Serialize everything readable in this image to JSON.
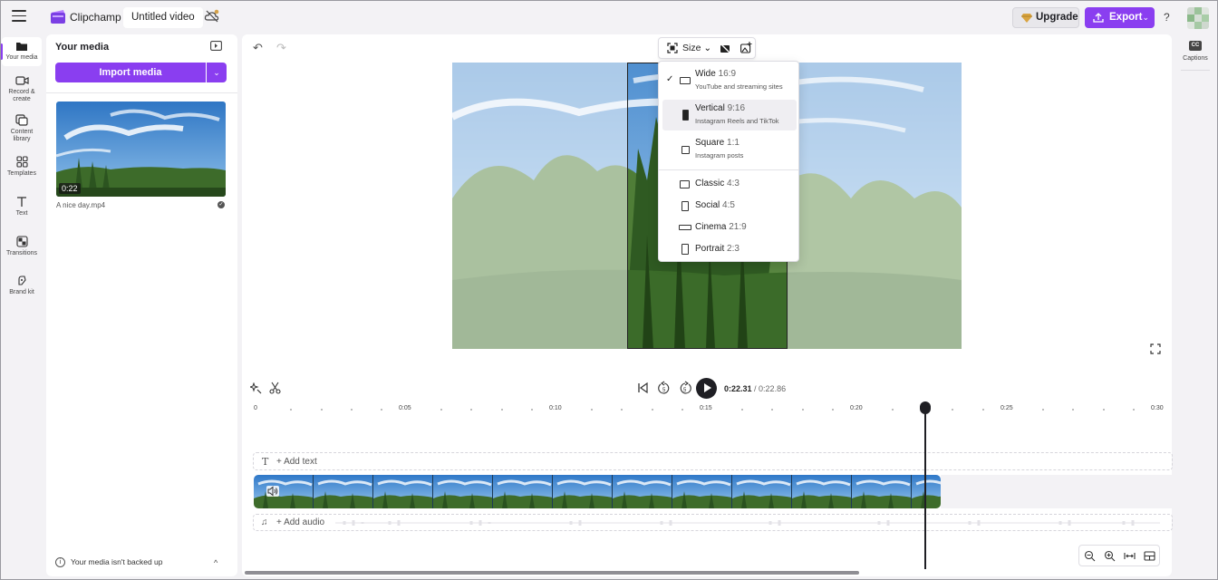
{
  "app": {
    "name": "Clipchamp",
    "project_title": "Untitled video"
  },
  "header": {
    "upgrade_label": "Upgrade",
    "export_label": "Export",
    "export_dropdown": "⌄",
    "help_label": "?"
  },
  "rail": {
    "items": [
      {
        "label": "Your media",
        "icon": "folder-icon",
        "active": true
      },
      {
        "label": "Record & create",
        "icon": "camera-icon"
      },
      {
        "label": "Content library",
        "icon": "library-icon"
      },
      {
        "label": "Templates",
        "icon": "templates-icon"
      },
      {
        "label": "Text",
        "icon": "text-icon"
      },
      {
        "label": "Transitions",
        "icon": "transitions-icon"
      },
      {
        "label": "Brand kit",
        "icon": "brand-kit-icon"
      }
    ]
  },
  "media": {
    "title": "Your media",
    "import_label": "Import media",
    "import_dropdown": "⌄",
    "file": {
      "duration": "0:22",
      "name": "A nice day.mp4"
    },
    "backup_text": "Your media isn't backed up",
    "backup_chevron": "^"
  },
  "toolbar": {
    "size_label": "Size",
    "size_chevron": "⌄"
  },
  "size_menu": {
    "options": [
      {
        "name": "Wide",
        "ratio": "16:9",
        "desc": "YouTube and streaming sites",
        "checked": true
      },
      {
        "name": "Vertical",
        "ratio": "9:16",
        "desc": "Instagram Reels and TikTok",
        "highlighted": true
      },
      {
        "name": "Square",
        "ratio": "1:1",
        "desc": "Instagram posts"
      },
      {
        "name": "Classic",
        "ratio": "4:3"
      },
      {
        "name": "Social",
        "ratio": "4:5"
      },
      {
        "name": "Cinema",
        "ratio": "21:9"
      },
      {
        "name": "Portrait",
        "ratio": "2:3"
      }
    ],
    "check_mark": "✓"
  },
  "transport": {
    "current_time": "0:22.31",
    "separator": " / ",
    "total_time": "0:22.86"
  },
  "ruler": {
    "labels": [
      "0",
      "0:05",
      "0:10",
      "0:15",
      "0:20",
      "0:25",
      "0:30"
    ]
  },
  "timeline": {
    "add_text_label": "+ Add text",
    "add_audio_label": "+ Add audio",
    "text_glyph": "T",
    "audio_glyph": "♫"
  },
  "right_rail": {
    "captions_label": "Captions",
    "cc_label": "CC"
  },
  "colors": {
    "accent": "#8a3ef0",
    "sky": "#8fb7dd",
    "foliage": "#3f6d2c"
  }
}
